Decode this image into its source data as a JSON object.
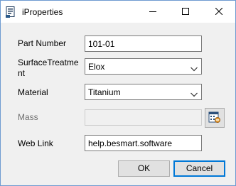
{
  "window": {
    "title": "iProperties",
    "icon": "window-app-icon",
    "controls": [
      "minimize-icon",
      "maximize-icon",
      "close-icon"
    ]
  },
  "form": {
    "part_number": {
      "label": "Part Number",
      "value": "101-01"
    },
    "surface_treatment": {
      "label_line1": "SurfaceTreatme",
      "label_line2": "nt",
      "value": "Elox"
    },
    "material": {
      "label": "Material",
      "value": "Titanium"
    },
    "mass": {
      "label": "Mass",
      "value": ""
    },
    "web_link": {
      "label": "Web Link",
      "value": "help.besmart.software"
    }
  },
  "buttons": {
    "ok": "OK",
    "cancel": "Cancel"
  },
  "colors": {
    "accent": "#0078d7",
    "window_border": "#6e9bd1",
    "client_bg": "#f0f0f0",
    "button_bg": "#e1e1e1"
  }
}
